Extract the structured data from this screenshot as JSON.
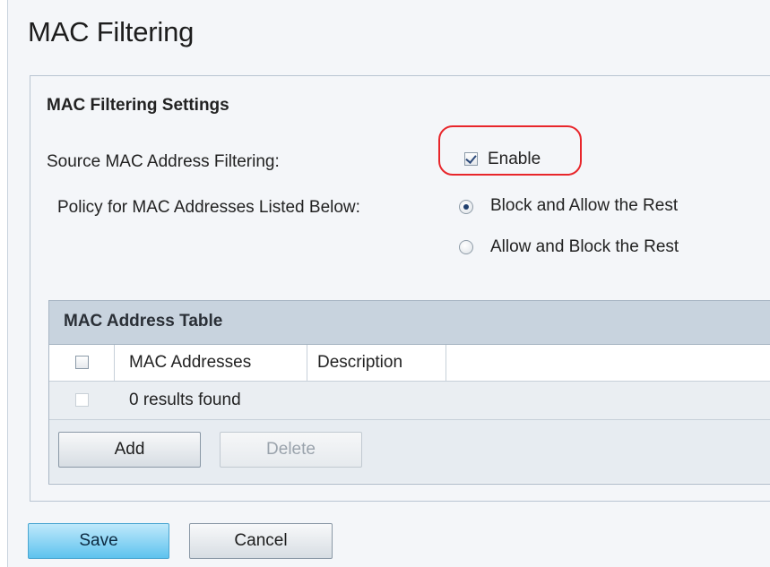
{
  "page": {
    "title": "MAC Filtering"
  },
  "settings": {
    "section_title": "MAC Filtering Settings",
    "source_filtering_label": "Source MAC Address Filtering:",
    "enable_label": "Enable",
    "enable_checked": true,
    "policy_label": "Policy for MAC Addresses Listed Below:",
    "policy_options": [
      {
        "label": "Block and Allow the Rest",
        "selected": true
      },
      {
        "label": "Allow and Block the Rest",
        "selected": false
      }
    ],
    "highlight_color": "#e8262b"
  },
  "table": {
    "title": "MAC Address Table",
    "columns": [
      "MAC Addresses",
      "Description"
    ],
    "empty_message": "0 results found",
    "add_label": "Add",
    "delete_label": "Delete"
  },
  "footer": {
    "save_label": "Save",
    "cancel_label": "Cancel"
  }
}
